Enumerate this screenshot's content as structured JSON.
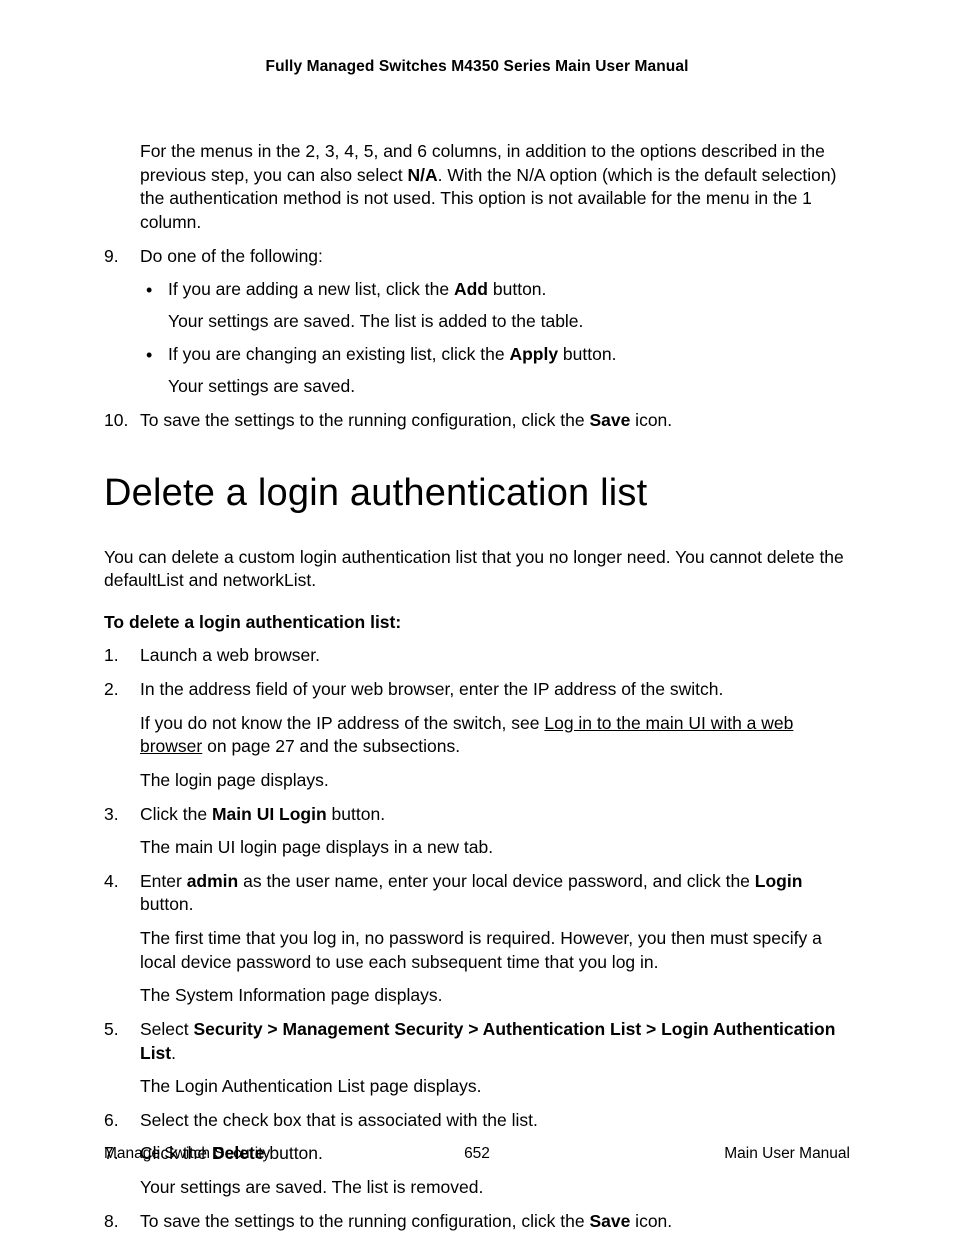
{
  "header": {
    "title": "Fully Managed Switches M4350 Series Main User Manual"
  },
  "intro": {
    "para_before": "For the menus in the 2, 3, 4, 5, and 6 columns, in addition to the options described in the previous step, you can also select ",
    "na_bold": "N/A",
    "para_after": ". With the N/A option (which is the default selection) the authentication method is not used. This option is not available for the menu in the 1 column."
  },
  "list_a": {
    "item9": {
      "num": "9.",
      "lead": "Do one of the following:",
      "bullets": [
        {
          "line1_pre": "If you are adding a new list, click the ",
          "line1_bold": "Add",
          "line1_post": " button.",
          "line2": "Your settings are saved. The list is added to the table."
        },
        {
          "line1_pre": "If you are changing an existing list, click the ",
          "line1_bold": "Apply",
          "line1_post": " button.",
          "line2": "Your settings are saved."
        }
      ]
    },
    "item10": {
      "num": "10.",
      "pre": "To save the settings to the running configuration, click the ",
      "bold": "Save",
      "post": " icon."
    }
  },
  "heading": "Delete a login authentication list",
  "intro2": "You can delete a custom login authentication list that you no longer need. You cannot delete the defaultList and networkList.",
  "subhead": "To delete a login authentication list:",
  "steps": {
    "s1": {
      "num": "1.",
      "text": "Launch a web browser."
    },
    "s2": {
      "num": "2.",
      "p1": "In the address field of your web browser, enter the IP address of the switch.",
      "p2_pre": "If you do not know the IP address of the switch, see ",
      "p2_link": "Log in to the main UI with a web browser",
      "p2_post": " on page 27 and the subsections.",
      "p3": "The login page displays."
    },
    "s3": {
      "num": "3.",
      "p1_pre": "Click the ",
      "p1_bold": "Main UI Login",
      "p1_post": " button.",
      "p2": "The main UI login page displays in a new tab."
    },
    "s4": {
      "num": "4.",
      "p1_pre": "Enter ",
      "p1_bold1": "admin",
      "p1_mid": " as the user name, enter your local device password, and click the ",
      "p1_bold2": "Login",
      "p1_post": " button.",
      "p2": "The first time that you log in, no password is required. However, you then must specify a local device password to use each subsequent time that you log in.",
      "p3": "The System Information page displays."
    },
    "s5": {
      "num": "5.",
      "p1_pre": "Select ",
      "p1_bold": "Security > Management Security > Authentication List > Login Authentication List",
      "p1_post": ".",
      "p2": "The Login Authentication List page displays."
    },
    "s6": {
      "num": "6.",
      "text": "Select the check box that is associated with the list."
    },
    "s7": {
      "num": "7.",
      "p1_pre": "Click the ",
      "p1_bold": "Delete",
      "p1_post": " button.",
      "p2": "Your settings are saved. The list is removed."
    },
    "s8": {
      "num": "8.",
      "pre": "To save the settings to the running configuration, click the ",
      "bold": "Save",
      "post": " icon."
    }
  },
  "footer": {
    "left": "Manage Switch Security",
    "center": "652",
    "right": "Main User Manual"
  }
}
